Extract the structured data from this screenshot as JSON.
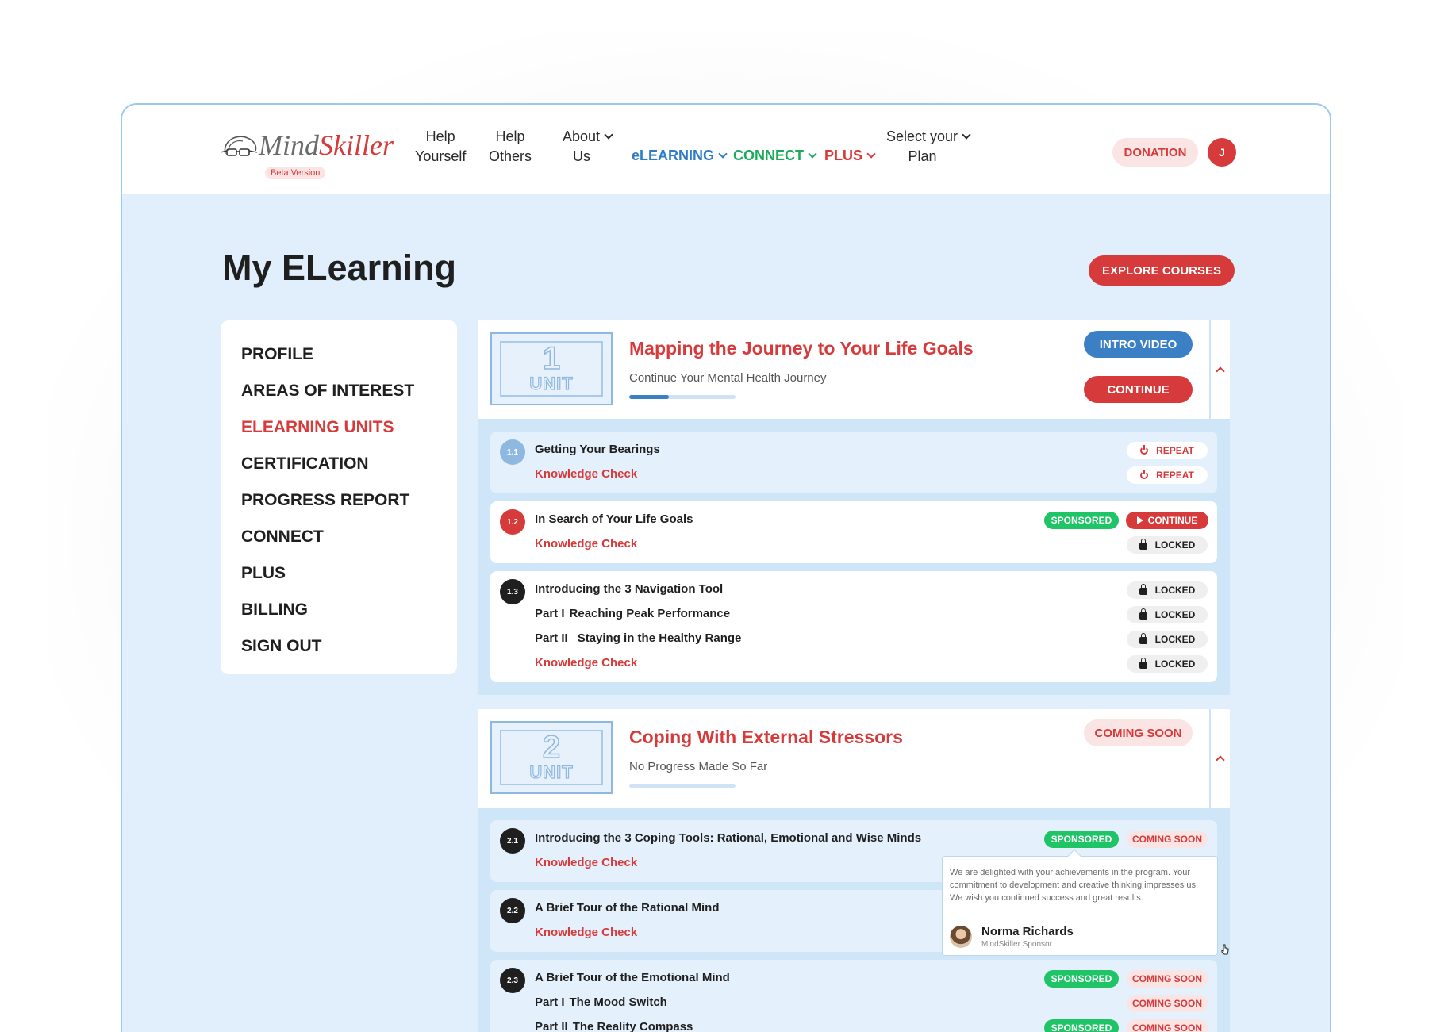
{
  "header": {
    "logo_mind": "Mind",
    "logo_skiller": "Skiller",
    "beta": "Beta Version",
    "nav": {
      "help_yourself": [
        "Help",
        "Yourself"
      ],
      "help_others": [
        "Help",
        "Others"
      ],
      "about_us": [
        "About",
        "Us"
      ],
      "elearning": "eLEARNING",
      "connect": "CONNECT",
      "plus": "PLUS",
      "select_plan": [
        "Select your",
        "Plan"
      ]
    },
    "donation": "DONATION",
    "avatar_initial": "J",
    "colors": {
      "elearning": "#2f7dc6",
      "connect": "#1daa5d",
      "plus": "#d63a3a"
    }
  },
  "page": {
    "title": "My ELearning",
    "explore_button": "EXPLORE COURSES"
  },
  "sidebar": {
    "items": [
      {
        "label": "PROFILE",
        "active": false
      },
      {
        "label": "AREAS OF INTEREST",
        "active": false
      },
      {
        "label": "ELEARNING UNITS",
        "active": true
      },
      {
        "label": "CERTIFICATION",
        "active": false
      },
      {
        "label": "PROGRESS REPORT",
        "active": false
      },
      {
        "label": "CONNECT",
        "active": false
      },
      {
        "label": "PLUS",
        "active": false
      },
      {
        "label": "BILLING",
        "active": false
      },
      {
        "label": "SIGN OUT",
        "active": false
      }
    ]
  },
  "units": [
    {
      "number": "1",
      "unit_label": "UNIT",
      "title": "Mapping the Journey to Your Life Goals",
      "subtitle": "Continue Your Mental Health Journey",
      "progress": 0.37,
      "intro_video": "INTRO VIDEO",
      "continue": "CONTINUE",
      "lessons": [
        {
          "id": "1.1",
          "title": "Getting Your Bearings",
          "knowledge_check": "Knowledge Check",
          "title_action": "REPEAT",
          "kc_action": "REPEAT"
        },
        {
          "id": "1.2",
          "title": "In Search of Your Life Goals",
          "knowledge_check": "Knowledge Check",
          "sponsored": "SPONSORED",
          "title_action": "CONTINUE",
          "kc_action": "LOCKED"
        },
        {
          "id": "1.3",
          "title": "Introducing the 3 Navigation Tool",
          "part1_label": "Part I",
          "part1_title": "Reaching Peak Performance",
          "part2_label": "Part II",
          "part2_title": "Staying in the Healthy Range",
          "knowledge_check": "Knowledge Check",
          "title_action": "LOCKED",
          "part1_action": "LOCKED",
          "part2_action": "LOCKED",
          "kc_action": "LOCKED"
        }
      ]
    },
    {
      "number": "2",
      "unit_label": "UNIT",
      "title": "Coping With External Stressors",
      "subtitle": "No Progress Made So Far",
      "progress": 0,
      "status": "COMING SOON",
      "lessons": [
        {
          "id": "2.1",
          "title": "Introducing the 3 Coping Tools: Rational, Emotional and Wise Minds",
          "knowledge_check": "Knowledge Check",
          "sponsored": "SPONSORED",
          "title_action": "COMING SOON"
        },
        {
          "id": "2.2",
          "title": "A Brief Tour of the Rational Mind",
          "knowledge_check": "Knowledge Check"
        },
        {
          "id": "2.3",
          "title": "A Brief Tour of the Emotional Mind",
          "part1_label": "Part I",
          "part1_title": "The Mood Switch",
          "part2_label": "Part II",
          "part2_title": "The Reality Compass",
          "sponsored": "SPONSORED",
          "title_action": "COMING SOON",
          "part1_action": "COMING SOON",
          "part2_sponsored": "SPONSORED",
          "part2_action": "COMING SOON"
        }
      ]
    }
  ],
  "tooltip": {
    "message": "We are delighted with your achievements in the program. Your commitment to development and creative thinking impresses us. We wish you continued success and great results.",
    "name": "Norma Richards",
    "role": "MindSkiller Sponsor"
  }
}
